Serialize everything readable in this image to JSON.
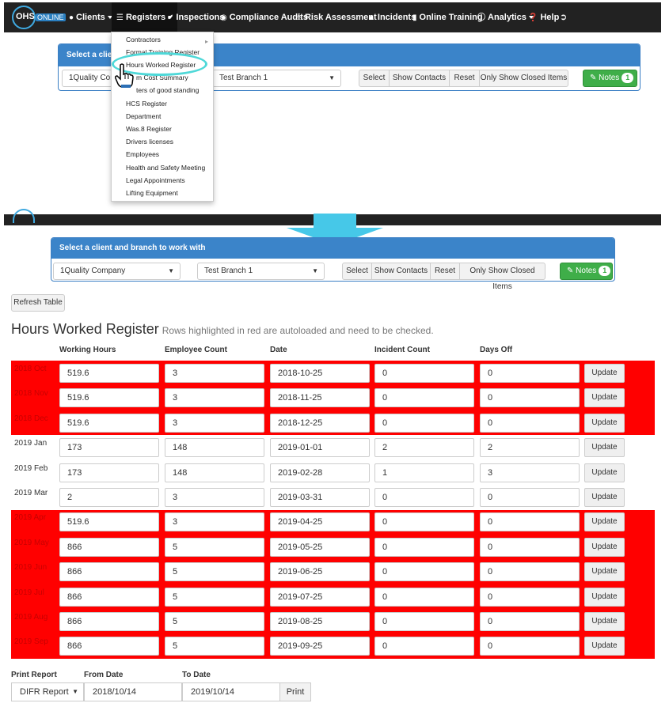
{
  "navbar": {
    "logo_text": "OHS",
    "logo_tag": "ONLINE",
    "items": [
      {
        "label": "Clients",
        "icon": "user-icon"
      },
      {
        "label": "Registers",
        "icon": "list-icon"
      },
      {
        "label": "Inspections",
        "icon": "check-icon"
      },
      {
        "label": "Compliance Audits",
        "icon": "eye-icon"
      },
      {
        "label": "Risk Assessment",
        "icon": "warning-icon"
      },
      {
        "label": "Incidents",
        "icon": "fire-icon"
      },
      {
        "label": "Online Training",
        "icon": "book-icon"
      },
      {
        "label": "Analytics",
        "icon": "info-icon"
      },
      {
        "label": "Help",
        "icon": "question-icon"
      }
    ]
  },
  "registers_menu": {
    "items": [
      "Contractors",
      "Formal Training Register",
      "Hours Worked Register",
      "m Cost Summary",
      "ters of good standing",
      "HCS Register",
      "Department",
      "Was.8 Register",
      "Drivers licenses",
      "Employees",
      "Health and Safety Meeting",
      "Legal Appointments",
      "Lifting Equipment"
    ]
  },
  "client_panel_top": {
    "heading": "Select a client",
    "client": "1Quality Com",
    "branch": "Test Branch 1"
  },
  "client_panel": {
    "heading": "Select a client and branch to work with",
    "client": "1Quality Company",
    "branch": "Test Branch 1",
    "select_label": "Select",
    "show_contacts_label": "Show Contacts",
    "reset_label": "Reset",
    "closed_items_label": "Only Show Closed Items",
    "notes_label": "Notes",
    "notes_count": "1"
  },
  "refresh_label": "Refresh Table",
  "register": {
    "title": "Hours Worked Register",
    "subtitle": "Rows highlighted in red are autoloaded and need to be checked.",
    "columns": [
      "Working Hours",
      "Employee Count",
      "Date",
      "Incident Count",
      "Days Off"
    ],
    "update_label": "Update",
    "rows": [
      {
        "period": "2018 Oct",
        "hours": "519.6",
        "employees": "3",
        "date": "2018-10-25",
        "incidents": "0",
        "days_off": "0",
        "autoloaded": true
      },
      {
        "period": "2018 Nov",
        "hours": "519.6",
        "employees": "3",
        "date": "2018-11-25",
        "incidents": "0",
        "days_off": "0",
        "autoloaded": true
      },
      {
        "period": "2018 Dec",
        "hours": "519.6",
        "employees": "3",
        "date": "2018-12-25",
        "incidents": "0",
        "days_off": "0",
        "autoloaded": true
      },
      {
        "period": "2019 Jan",
        "hours": "173",
        "employees": "148",
        "date": "2019-01-01",
        "incidents": "2",
        "days_off": "2",
        "autoloaded": false
      },
      {
        "period": "2019 Feb",
        "hours": "173",
        "employees": "148",
        "date": "2019-02-28",
        "incidents": "1",
        "days_off": "3",
        "autoloaded": false
      },
      {
        "period": "2019 Mar",
        "hours": "2",
        "employees": "3",
        "date": "2019-03-31",
        "incidents": "0",
        "days_off": "0",
        "autoloaded": false
      },
      {
        "period": "2019 Apr",
        "hours": "519.6",
        "employees": "3",
        "date": "2019-04-25",
        "incidents": "0",
        "days_off": "0",
        "autoloaded": true
      },
      {
        "period": "2019 May",
        "hours": "866",
        "employees": "5",
        "date": "2019-05-25",
        "incidents": "0",
        "days_off": "0",
        "autoloaded": true
      },
      {
        "period": "2019 Jun",
        "hours": "866",
        "employees": "5",
        "date": "2019-06-25",
        "incidents": "0",
        "days_off": "0",
        "autoloaded": true
      },
      {
        "period": "2019 Jul",
        "hours": "866",
        "employees": "5",
        "date": "2019-07-25",
        "incidents": "0",
        "days_off": "0",
        "autoloaded": true
      },
      {
        "period": "2019 Aug",
        "hours": "866",
        "employees": "5",
        "date": "2019-08-25",
        "incidents": "0",
        "days_off": "0",
        "autoloaded": true
      },
      {
        "period": "2019 Sep",
        "hours": "866",
        "employees": "5",
        "date": "2019-09-25",
        "incidents": "0",
        "days_off": "0",
        "autoloaded": true
      }
    ]
  },
  "print_report": {
    "label": "Print Report",
    "from_label": "From Date",
    "to_label": "To Date",
    "report_type": "DIFR Report",
    "from_date": "2018/10/14",
    "to_date": "2019/10/14",
    "print_label": "Print"
  },
  "colors": {
    "navbar": "#222222",
    "panel_header": "#3b84c9",
    "autoload_red": "#ff0000",
    "notes_green": "#3fae49",
    "highlight_ring": "#4ed8d8",
    "arrow": "#46c8e8"
  }
}
